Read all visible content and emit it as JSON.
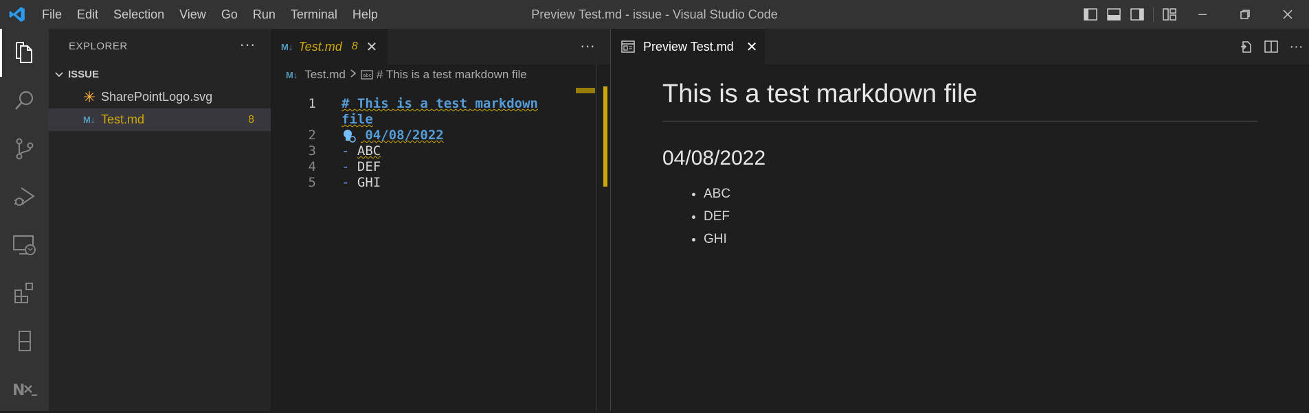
{
  "titlebar": {
    "menu": [
      "File",
      "Edit",
      "Selection",
      "View",
      "Go",
      "Run",
      "Terminal",
      "Help"
    ],
    "window_title": "Preview Test.md - issue - Visual Studio Code"
  },
  "activity_bar": [
    "explorer-icon",
    "search-icon",
    "source-control-icon",
    "run-debug-icon",
    "remote-explorer-icon",
    "extensions-icon",
    "notebook-icon",
    "nx-icon"
  ],
  "sidebar": {
    "title": "EXPLORER",
    "folder": "ISSUE",
    "files": [
      {
        "name": "SharePointLogo.svg",
        "icon": "svg-file-icon"
      },
      {
        "name": "Test.md",
        "icon": "markdown-file-icon",
        "badge": "8",
        "color": "#cca700"
      }
    ]
  },
  "editor": {
    "tab": {
      "label": "Test.md",
      "count": "8",
      "icon_text": "M↓"
    },
    "breadcrumb": {
      "file": "Test.md",
      "symbol": "# This is a test markdown file"
    },
    "lines": [
      {
        "num": "1",
        "text_a": "# This is a test markdown",
        "text_b": "file"
      },
      {
        "num": "2",
        "text": "## 04/08/2022"
      },
      {
        "num": "3",
        "dash": "-",
        "text": "ABC"
      },
      {
        "num": "4",
        "dash": "-",
        "text": "DEF"
      },
      {
        "num": "5",
        "dash": "-",
        "text": "GHI"
      }
    ]
  },
  "preview": {
    "tab_label": "Preview Test.md",
    "h1": "This is a test markdown file",
    "h2": "04/08/2022",
    "items": [
      "ABC",
      "DEF",
      "GHI"
    ]
  },
  "colors": {
    "accent": "#cca700",
    "heading": "#569cd6",
    "background": "#1e1e1e"
  }
}
